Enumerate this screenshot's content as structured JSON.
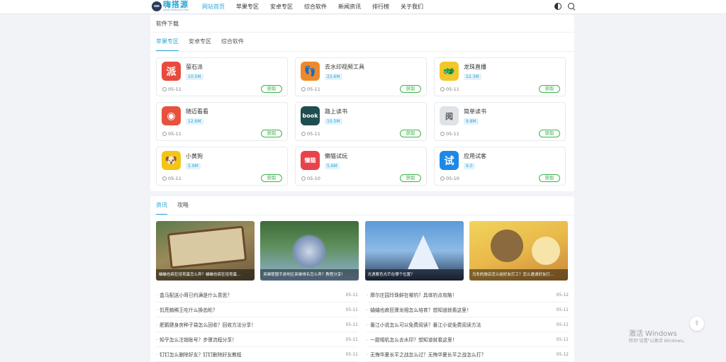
{
  "header": {
    "logo_title": "嗨搭源",
    "logo_sub": "www.haidayuan.com",
    "nav": [
      "网站首页",
      "苹果专区",
      "安卓专区",
      "综合软件",
      "新闻资讯",
      "排行榜",
      "关于我们"
    ],
    "active_nav": "网站首页"
  },
  "software": {
    "title": "软件下载",
    "tabs": [
      "苹果专区",
      "安卓专区",
      "综合软件"
    ],
    "active_tab": "苹果专区",
    "get_label": "获取",
    "apps": [
      {
        "name": "萤石派",
        "size": "10.5M",
        "date": "05-11",
        "icon": "派",
        "color": "#e84b3c"
      },
      {
        "name": "去水印视频工具",
        "size": "22.6M",
        "date": "05-11",
        "icon": "👣",
        "color": "#ef8a2a"
      },
      {
        "name": "龙珠直播",
        "size": "22.3M",
        "date": "05-11",
        "icon": "🐲",
        "color": "#f3c62a"
      },
      {
        "name": "随迈看看",
        "size": "12.6M",
        "date": "05-11",
        "icon": "◉",
        "color": "#e8513d"
      },
      {
        "name": "路上读书",
        "size": "10.5M",
        "date": "05-11",
        "icon": "book",
        "color": "#1f4d50"
      },
      {
        "name": "简单读书",
        "size": "9.8M",
        "date": "05-11",
        "icon": "阅",
        "color": "#dfe3e8"
      },
      {
        "name": "小黄狗",
        "size": "5.9M",
        "date": "05-11",
        "icon": "🐶",
        "color": "#f5c515"
      },
      {
        "name": "懒猫试玩",
        "size": "5.6M",
        "date": "05-10",
        "icon": "懒猫",
        "color": "#e8434b"
      },
      {
        "name": "应用试客",
        "size": "9.0",
        "date": "05-10",
        "icon": "试",
        "color": "#1e88e5"
      }
    ]
  },
  "news": {
    "tabs": [
      "资讯",
      "攻略"
    ],
    "active_tab": "资讯",
    "thumbs": [
      {
        "caption": "蛐蛐也疯狂培育蛋怎么弄？蛐蛐也疯狂培育蛋…"
      },
      {
        "caption": "英雄联盟手游地区英雄排名怎么弄？教程分享！"
      },
      {
        "caption": "光遇紫色光芒在哪个位置？"
      },
      {
        "caption": "乌冬的旅店怎么给好友打工？怎么邀请好友打…"
      }
    ],
    "items_left": [
      {
        "title": "盒马配送小哥已约满是什么意思？",
        "date": "05-11"
      },
      {
        "title": "饥荒植稀王吃什么换齿轮？",
        "date": "05-11"
      },
      {
        "title": "肥鹅健身房种子袋怎么回收？回收方法分享！",
        "date": "05-11"
      },
      {
        "title": "知乎怎么注销账号？步骤流程分享！",
        "date": "05-11"
      },
      {
        "title": "钉钉怎么删除好友？钉钉删除好友教程",
        "date": "05-11"
      }
    ],
    "items_right": [
      {
        "title": "摩尔庄园玲珠鲜在哪钓？具体钓点攻略！",
        "date": "05-12"
      },
      {
        "title": "蛐蛐也疯狂骤龙相怎么培育？想知道就看这里！",
        "date": "05-11"
      },
      {
        "title": "番江小说怎么可以免费阅读？番江小说免费阅读方法",
        "date": "05-11"
      },
      {
        "title": "一甜相机怎么去水印？想知道就看这里！",
        "date": "05-11"
      },
      {
        "title": "无悔华夏长平之战怎么过？无悔华夏长平之战怎么打？",
        "date": "05-12"
      }
    ]
  },
  "back_top_icon": "back-to-top-icon",
  "watermark": {
    "line1": "激活 Windows",
    "line2": "转到\"设置\"以激活 Windows。"
  }
}
